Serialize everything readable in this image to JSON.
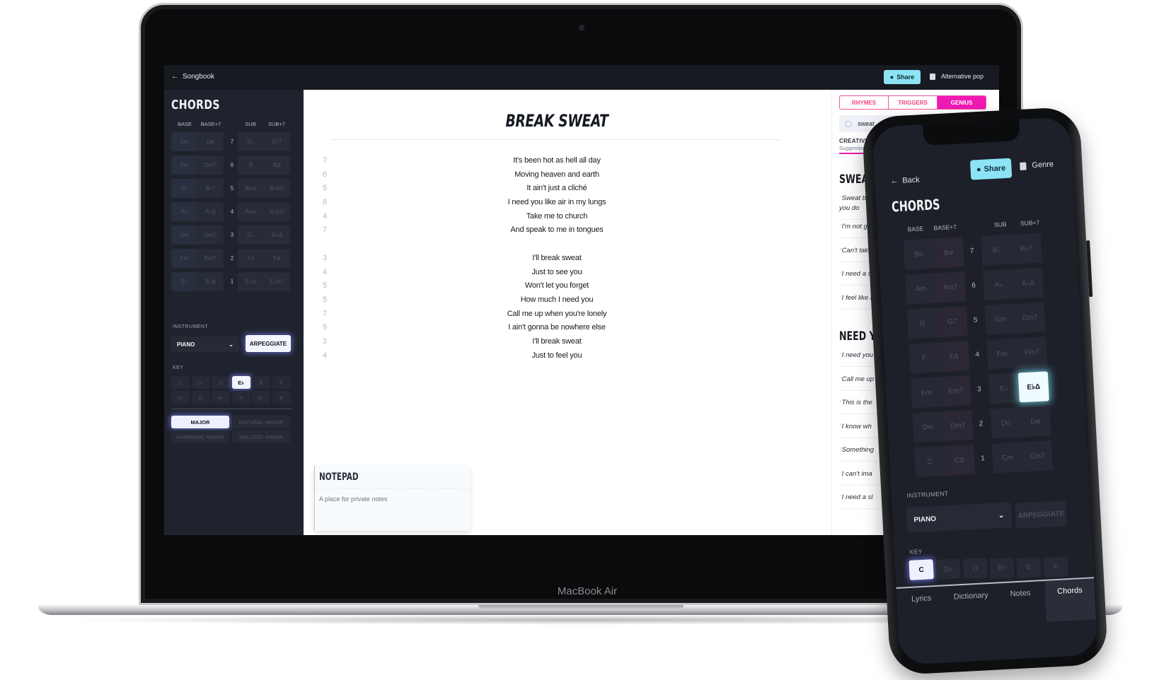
{
  "device": {
    "laptop_label": "MacBook Air"
  },
  "topbar": {
    "back_label": "Songbook",
    "share_label": "Share",
    "genre_label": "Alternative pop"
  },
  "sidebar": {
    "title": "CHORDS",
    "column_headers": [
      "BASE",
      "BASE+7",
      "SUB",
      "SUB+7"
    ],
    "rows": [
      {
        "degree": "7",
        "base": "Do",
        "base7": "Dø",
        "sub": "D♭",
        "sub7": "D♭7"
      },
      {
        "degree": "6",
        "base": "Cm",
        "base7": "Cm7",
        "sub": "B",
        "sub7": "BΔ"
      },
      {
        "degree": "5",
        "base": "B♭",
        "base7": "B♭7",
        "sub": "B♭m",
        "sub7": "B♭m7"
      },
      {
        "degree": "4",
        "base": "A♭",
        "base7": "A♭Δ",
        "sub": "A♭m",
        "sub7": "A♭m7"
      },
      {
        "degree": "3",
        "base": "Gm",
        "base7": "Gm7",
        "sub": "G♭",
        "sub7": "G♭Δ"
      },
      {
        "degree": "2",
        "base": "Fm",
        "base7": "Fm7",
        "sub": "Fo",
        "sub7": "Fø"
      },
      {
        "degree": "1",
        "base": "E♭",
        "base7": "E♭Δ",
        "sub": "E♭m",
        "sub7": "E♭m7"
      }
    ],
    "instrument_label": "INSTRUMENT",
    "instrument_value": "PIANO",
    "arpeggiate_label": "ARPEGGIATE",
    "key_label": "KEY",
    "keys_row1": [
      "C",
      "D♭",
      "D",
      "E♭",
      "E",
      "F"
    ],
    "keys_row2": [
      "G♭",
      "G",
      "A♭",
      "A",
      "B♭",
      "B"
    ],
    "selected_key": "E♭",
    "modes": [
      "MAJOR",
      "NATURAL MINOR",
      "HARMONIC MINOR",
      "MELODIC MINOR"
    ],
    "selected_mode": "MAJOR"
  },
  "main": {
    "song_title": "BREAK SWEAT",
    "lyrics": [
      {
        "syllables": "7",
        "text": "It's been hot as hell all day"
      },
      {
        "syllables": "6",
        "text": "Moving heaven and earth"
      },
      {
        "syllables": "5",
        "text": "It ain't just a cliché"
      },
      {
        "syllables": "8",
        "text": "I need you like air in my lungs"
      },
      {
        "syllables": "4",
        "text": "Take me to church"
      },
      {
        "syllables": "7",
        "text": "And speak to me in tongues"
      },
      {
        "syllables": "",
        "text": ""
      },
      {
        "syllables": "3",
        "text": "I'll break sweat"
      },
      {
        "syllables": "4",
        "text": "Just to see you"
      },
      {
        "syllables": "5",
        "text": "Won't let you forget"
      },
      {
        "syllables": "5",
        "text": "How much I need you"
      },
      {
        "syllables": "7",
        "text": "Call me up when you're lonely"
      },
      {
        "syllables": "9",
        "text": "I ain't gonna be nowhere else"
      },
      {
        "syllables": "3",
        "text": "I'll break sweat"
      },
      {
        "syllables": "4",
        "text": "Just to feel you"
      }
    ],
    "notepad": {
      "title": "NOTEPAD",
      "placeholder": "A place for private notes"
    }
  },
  "right_panel": {
    "tabs": [
      "RHYMES",
      "TRIGGERS",
      "GENIUS"
    ],
    "active_tab": "GENIUS",
    "search_value": "sweat",
    "creativity_label": "CREATIVITY",
    "creativity_sub": "Suggestions a",
    "sections": [
      {
        "title": "SWEAT",
        "quotes": [
          "Sweat be",
          "you do",
          "I'm not go",
          "Can't take",
          "I need a sl",
          "I feel like I"
        ]
      },
      {
        "title": "NEED YO",
        "quotes": [
          "I need you",
          "Call me up",
          "This is the",
          "I know wh",
          "Something",
          "I can't ima",
          "I need a sl"
        ]
      }
    ]
  },
  "phone": {
    "back_label": "Back",
    "share_label": "Share",
    "genre_label": "Genre",
    "title": "CHORDS",
    "column_headers": [
      "BASE",
      "BASE+7",
      "SUB",
      "SUB+7"
    ],
    "rows": [
      {
        "degree": "7",
        "base": "Bo",
        "base7": "Bø",
        "sub": "B♭",
        "sub7": "B♭7"
      },
      {
        "degree": "6",
        "base": "Am",
        "base7": "Am7",
        "sub": "A♭",
        "sub7": "A♭Δ"
      },
      {
        "degree": "5",
        "base": "G",
        "base7": "G7",
        "sub": "Gm",
        "sub7": "Gm7"
      },
      {
        "degree": "4",
        "base": "F",
        "base7": "FΔ",
        "sub": "Fm",
        "sub7": "Fm7"
      },
      {
        "degree": "3",
        "base": "Em",
        "base7": "Em7",
        "sub": "E♭",
        "sub7": "E♭Δ"
      },
      {
        "degree": "2",
        "base": "Dm",
        "base7": "Dm7",
        "sub": "Do",
        "sub7": "Dø"
      },
      {
        "degree": "1",
        "base": "C",
        "base7": "CΔ",
        "sub": "Cm",
        "sub7": "Cm7"
      }
    ],
    "selected_chord": "E♭Δ",
    "instrument_label": "INSTRUMENT",
    "instrument_value": "PIANO",
    "arpeggiate_label": "ARPEGGIATE",
    "key_label": "KEY",
    "keys": [
      "C",
      "D♭",
      "D",
      "E♭",
      "E",
      "F"
    ],
    "selected_key": "C",
    "tabs": [
      "Lyrics",
      "Dictionary",
      "Notes",
      "Chords"
    ],
    "active_tab": "Chords"
  },
  "colors": {
    "accent_cyan": "#8be3f5",
    "accent_magenta": "#f019b4",
    "accent_pink": "#f0447f",
    "dark_bg": "#1f232d"
  }
}
